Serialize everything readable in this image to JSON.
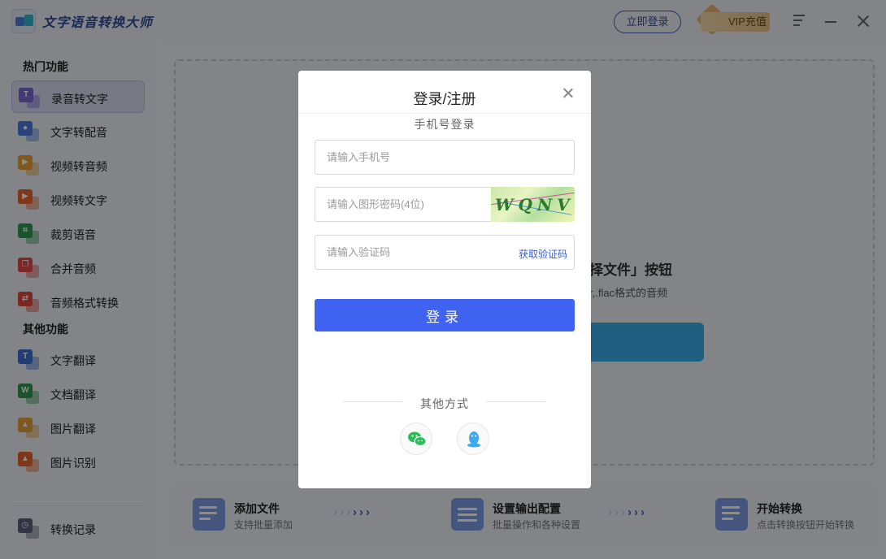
{
  "app": {
    "title": "文字语音转换大师",
    "login_label": "立即登录",
    "vip_label": "VIP充值",
    "icons": {
      "logo": "app-logo-icon",
      "menu": "menu-icon",
      "minimize": "minimize-icon",
      "close": "close-icon"
    }
  },
  "sidebar": {
    "hot_title": "热门功能",
    "hot_items": [
      {
        "label": "录音转文字",
        "icon": "record-to-text-icon",
        "color": "#7a69d6"
      },
      {
        "label": "文字转配音",
        "icon": "text-to-voice-icon",
        "color": "#4b7de0"
      },
      {
        "label": "视频转音频",
        "icon": "video-to-audio-icon",
        "color": "#e8a13a"
      },
      {
        "label": "视频转文字",
        "icon": "video-to-text-icon",
        "color": "#e7642d"
      },
      {
        "label": "裁剪语音",
        "icon": "crop-audio-icon",
        "color": "#2f9a53"
      },
      {
        "label": "合并音频",
        "icon": "merge-audio-icon",
        "color": "#e24a4a"
      },
      {
        "label": "音频格式转换",
        "icon": "audio-format-icon",
        "color": "#e2493f"
      }
    ],
    "other_title": "其他功能",
    "other_items": [
      {
        "label": "文字翻译",
        "icon": "text-translate-icon",
        "color": "#3f6fd8"
      },
      {
        "label": "文档翻译",
        "icon": "doc-translate-icon",
        "color": "#2f9a53"
      },
      {
        "label": "图片翻译",
        "icon": "image-translate-icon",
        "color": "#e8a13a"
      },
      {
        "label": "图片识别",
        "icon": "image-recognize-icon",
        "color": "#e7642d"
      }
    ],
    "history_label": "转换记录"
  },
  "main": {
    "hint_title": "择文件」按钮",
    "hint_sub": "r,.flac格式的音频",
    "steps": [
      {
        "title": "添加文件",
        "sub": "支持批量添加",
        "icon": "add-file-icon"
      },
      {
        "title": "设置输出配置",
        "sub": "批量操作和各种设置",
        "icon": "output-settings-icon"
      },
      {
        "title": "开始转换",
        "sub": "点击转换按钮开始转换",
        "icon": "start-convert-icon"
      }
    ]
  },
  "modal": {
    "title": "登录/注册",
    "subtitle": "手机号登录",
    "phone_placeholder": "请输入手机号",
    "captcha_placeholder": "请输入图形密码(4位)",
    "captcha_text": "WQNV",
    "code_placeholder": "请输入验证码",
    "get_code_label": "获取验证码",
    "submit_label": "登录",
    "other_label": "其他方式",
    "social": [
      {
        "name": "wechat",
        "icon": "wechat-icon",
        "color": "#2bbd5a"
      },
      {
        "name": "qq",
        "icon": "qq-icon",
        "color": "#3ea9f0"
      }
    ]
  }
}
